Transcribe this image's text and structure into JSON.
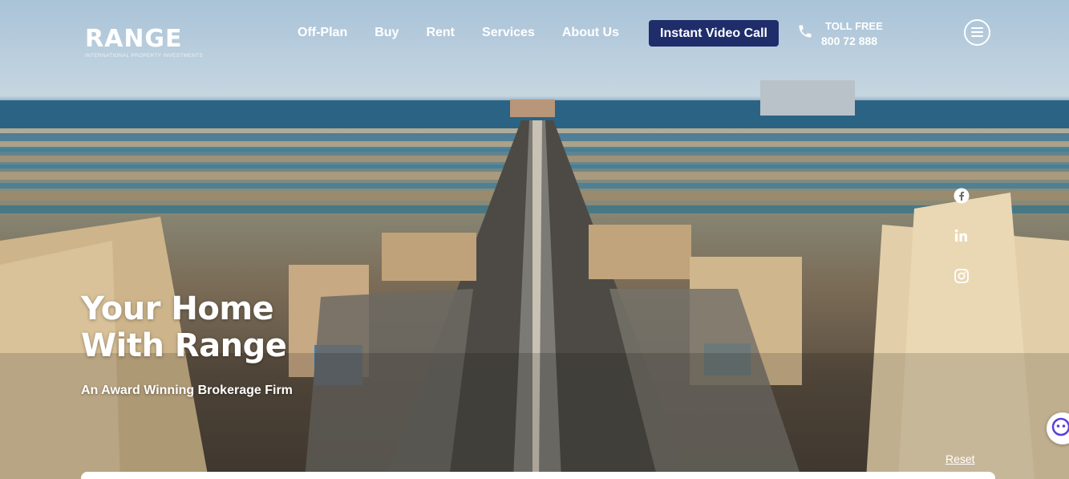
{
  "brand": {
    "name": "RANGE",
    "tagline": "INTERNATIONAL PROPERTY INVESTMENTS"
  },
  "nav": {
    "items": [
      {
        "label": "Off-Plan"
      },
      {
        "label": "Buy"
      },
      {
        "label": "Rent"
      },
      {
        "label": "Services"
      },
      {
        "label": "About Us"
      }
    ],
    "cta_label": "Instant Video Call"
  },
  "contact": {
    "toll_free_label": "TOLL FREE",
    "phone_number": "800 72 888",
    "icon": "phone-icon"
  },
  "menu": {
    "icon": "hamburger-menu-icon"
  },
  "social": [
    {
      "icon": "facebook-icon"
    },
    {
      "icon": "linkedin-icon"
    },
    {
      "icon": "instagram-icon"
    }
  ],
  "hero": {
    "headline_line1": "Your Home",
    "headline_line2": "With Range",
    "subheadline": "An Award Winning Brokerage Firm"
  },
  "search": {
    "reset_label": "Reset"
  },
  "colors": {
    "cta_background": "#1f2d6b",
    "text": "#ffffff",
    "chat_accent": "#5b3fd9"
  }
}
